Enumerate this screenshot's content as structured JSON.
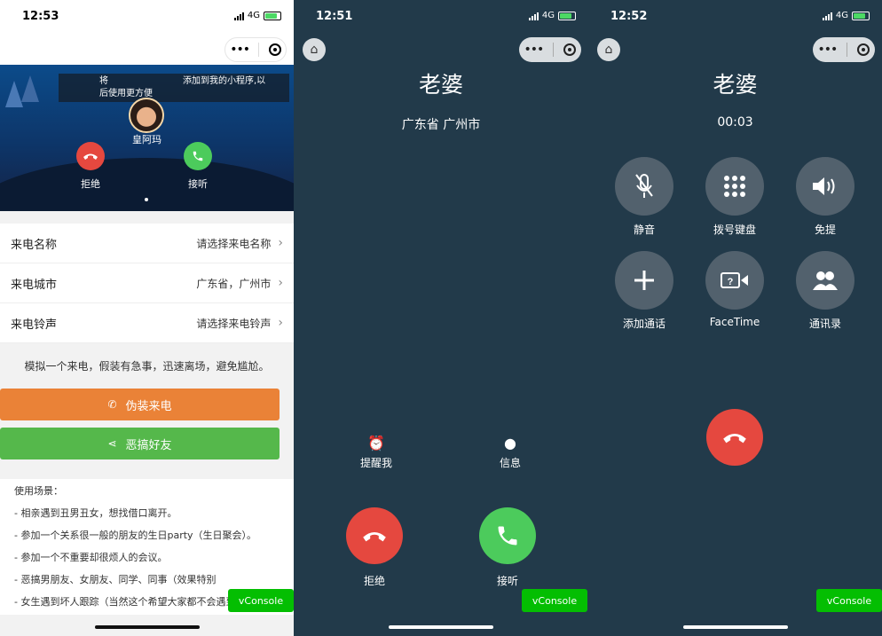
{
  "screen1": {
    "status": {
      "time": "12:53",
      "network": "4G"
    },
    "tip": {
      "line_a": "将",
      "line_b": "添加到我的小程序,以",
      "line_c": "后使用更方便"
    },
    "caller_name": "皇阿玛",
    "reject_label": "拒绝",
    "answer_label": "接听",
    "form": [
      {
        "label": "来电名称",
        "value": "请选择来电名称"
      },
      {
        "label": "来电城市",
        "value": "广东省，广州市"
      },
      {
        "label": "来电铃声",
        "value": "请选择来电铃声"
      }
    ],
    "description": "模拟一个来电，假装有急事，迅速离场，避免尴尬。",
    "fake_call_button": "伪装来电",
    "prank_button": "恶搞好友",
    "usage": [
      "使用场景：",
      "- 相亲遇到丑男丑女，想找借口离开。",
      "- 参加一个关系很一般的朋友的生日party（生日聚会）。",
      "- 参加一个不重要却很烦人的会议。",
      "- 恶搞男朋友、女朋友、同学、同事（效果特别",
      "- 女生遇到坏人跟踪（当然这个希望大家都不会遇到）。"
    ],
    "vconsole": "vConsole",
    "colors": {
      "orange": "#ea8237",
      "green": "#55b84b",
      "reject": "#e5483f",
      "answer": "#4ccb5c"
    }
  },
  "screen2": {
    "status": {
      "time": "12:51",
      "network": "4G"
    },
    "caller": "老婆",
    "location": "广东省 广州市",
    "remind_label": "提醒我",
    "message_label": "信息",
    "reject_label": "拒绝",
    "answer_label": "接听",
    "vconsole": "vConsole"
  },
  "screen3": {
    "status": {
      "time": "12:52",
      "network": "4G"
    },
    "caller": "老婆",
    "duration": "00:03",
    "controls": [
      {
        "label": "静音",
        "icon": "mic-off-icon"
      },
      {
        "label": "拨号键盘",
        "icon": "keypad-icon"
      },
      {
        "label": "免提",
        "icon": "speaker-icon"
      },
      {
        "label": "添加通话",
        "icon": "plus-icon"
      },
      {
        "label": "FaceTime",
        "icon": "facetime-icon"
      },
      {
        "label": "通讯录",
        "icon": "contacts-icon"
      }
    ],
    "vconsole": "vConsole"
  }
}
